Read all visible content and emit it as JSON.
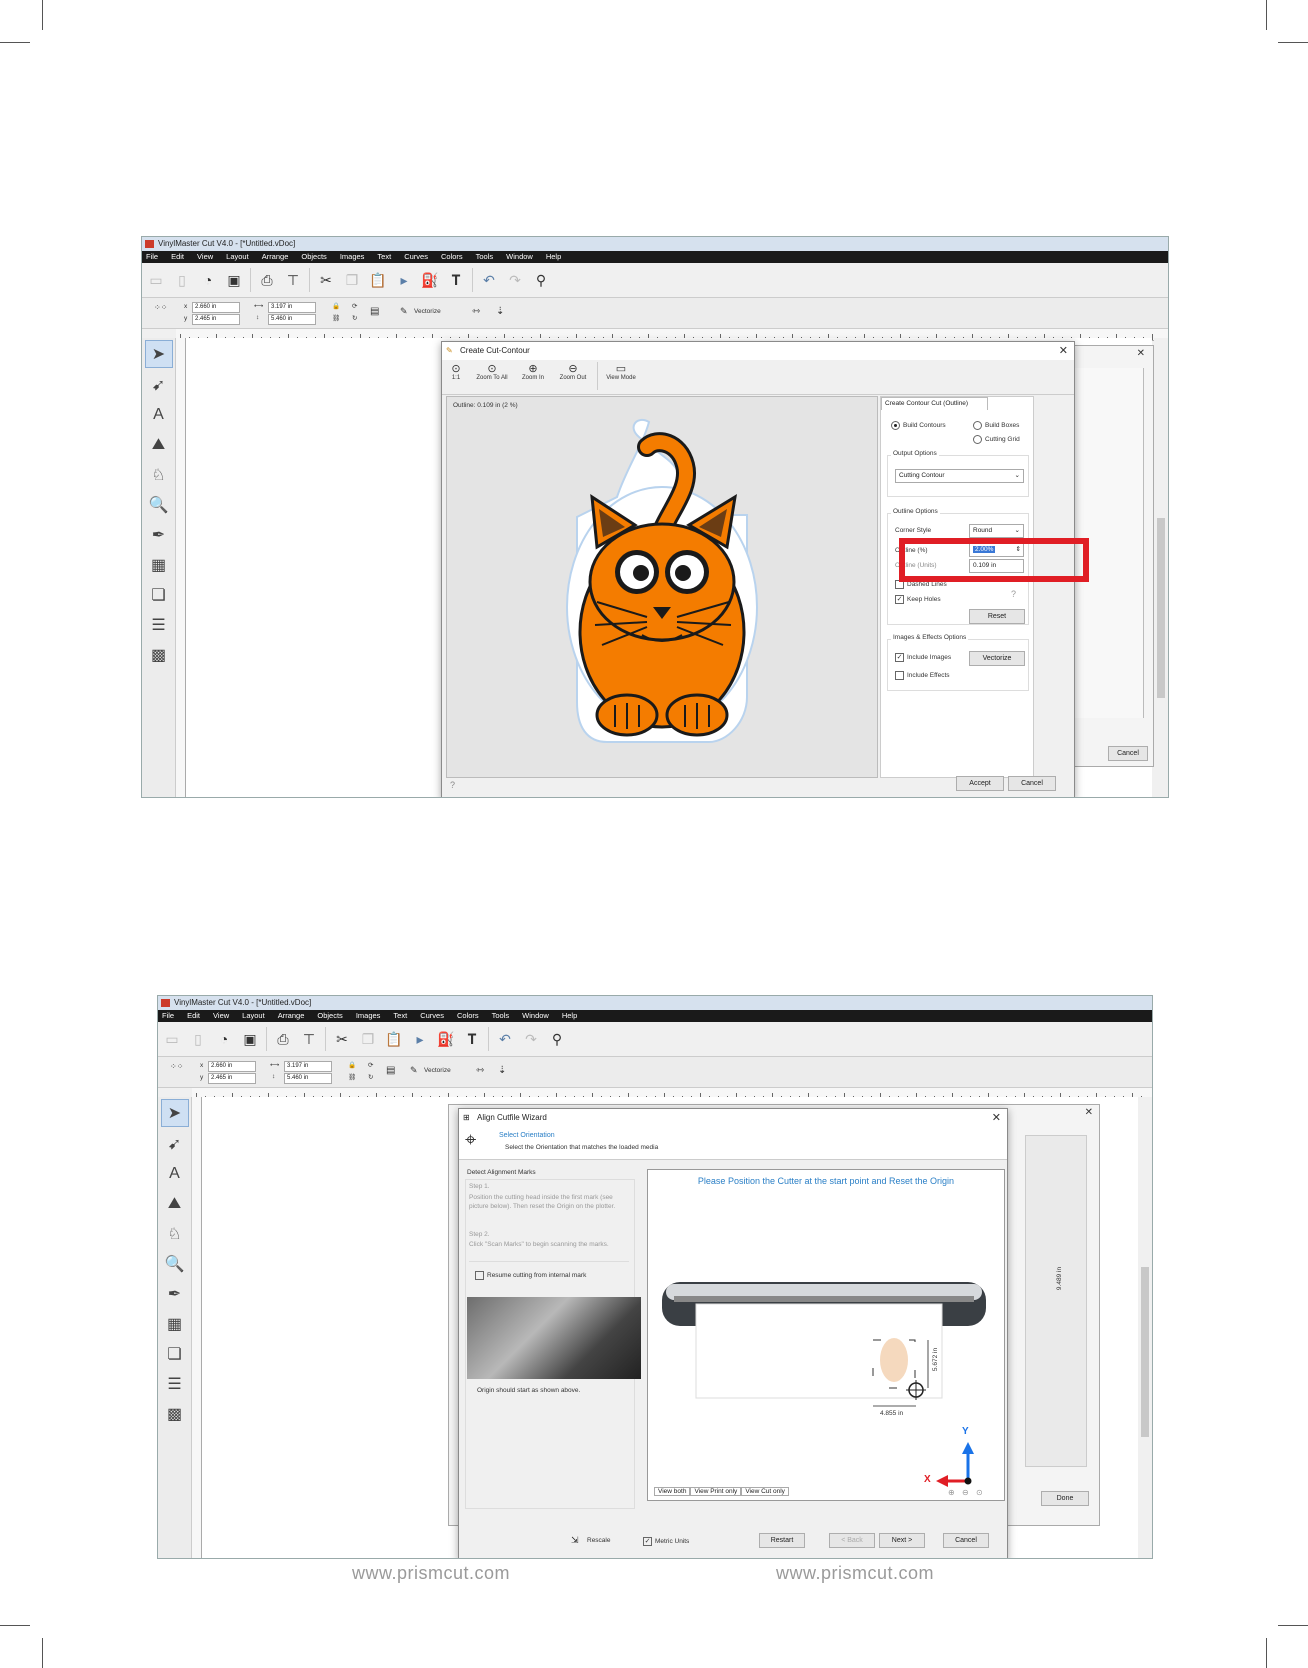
{
  "footer": {
    "left_url": "www.prismcut.com",
    "right_url": "www.prismcut.com"
  },
  "app": {
    "title": "VinylMaster Cut V4.0 - [*Untitled.vDoc]",
    "menu": [
      "File",
      "Edit",
      "View",
      "Layout",
      "Arrange",
      "Objects",
      "Images",
      "Text",
      "Curves",
      "Colors",
      "Tools",
      "Window",
      "Help"
    ],
    "props": {
      "x_label": "x",
      "y_label": "y",
      "x": "2.660 in",
      "y": "2.465 in",
      "w": "3.197 in",
      "h": "5.460 in",
      "vectorize": "Vectorize"
    }
  },
  "contour": {
    "dialog_title": "Create Cut-Contour",
    "toolbar": [
      "1:1",
      "Zoom To All",
      "Zoom In",
      "Zoom Out",
      "View Mode"
    ],
    "outline_info": "Outline: 0.109 in (2 %)",
    "tab": "Create Contour Cut (Outline)",
    "build_contours": "Build Contours",
    "build_boxes": "Build Boxes",
    "cutting_grid": "Cutting Grid",
    "output_options": "Output Options",
    "output_value": "Cutting Contour",
    "outline_options": "Outline Options",
    "corner_style": "Corner Style",
    "corner_value": "Round",
    "outline_pct_label": "Outline (%)",
    "outline_pct_value": "2.00%",
    "outline_units_label": "Outline (Units)",
    "outline_units_value": "0.109 in",
    "dashed_lines": "Dashed Lines",
    "keep_holes": "Keep Holes",
    "reset": "Reset",
    "images_effects": "Images & Effects Options",
    "include_images": "Include Images",
    "include_effects": "Include Effects",
    "vectorize": "Vectorize",
    "accept": "Accept",
    "cancel": "Cancel",
    "bg_cancel": "Cancel"
  },
  "wizard": {
    "dialog_title": "Align Cutfile Wizard",
    "header_title": "Select Orientation",
    "header_sub": "Select the Orientation that matches the loaded media",
    "detect": "Detect Alignment Marks",
    "step1_title": "Step 1.",
    "step1_text": "Position the cutting head inside the first mark (see picture below). Then reset the Origin on the plotter.",
    "step2_title": "Step 2.",
    "step2_text": "Click \"Scan Marks\" to begin scanning the marks.",
    "resume": "Resume cutting from internal mark",
    "origin_note": "Origin should start as shown above.",
    "position_msg": "Please Position the Cutter at the start point and Reset the Origin",
    "dim_height": "5.672 in",
    "dim_width": "4.855 in",
    "dim_side": "9.489 in",
    "axis_x": "X",
    "axis_y": "Y",
    "tabs": [
      "View both",
      "View Print only",
      "View Cut only"
    ],
    "rescale": "Rescale",
    "metric": "Metric Units",
    "restart": "Restart",
    "back": "< Back",
    "next": "Next >",
    "cancel": "Cancel",
    "done": "Done"
  },
  "colors": {
    "highlight": "#e01e25",
    "cat_orange": "#f47c00",
    "accent_blue": "#2a7fc6"
  }
}
